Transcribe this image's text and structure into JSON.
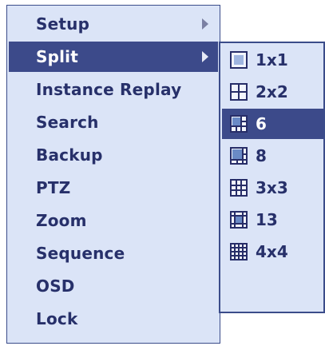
{
  "menu": {
    "items": [
      {
        "label": "Setup",
        "has_submenu": true
      },
      {
        "label": "Split",
        "has_submenu": true,
        "active": true
      },
      {
        "label": "Instance Replay"
      },
      {
        "label": "Search"
      },
      {
        "label": "Backup"
      },
      {
        "label": "PTZ"
      },
      {
        "label": "Zoom"
      },
      {
        "label": "Sequence"
      },
      {
        "label": "OSD"
      },
      {
        "label": "Lock"
      }
    ]
  },
  "split_submenu": {
    "items": [
      {
        "label": "1x1",
        "icon": "split-1x1-icon"
      },
      {
        "label": "2x2",
        "icon": "split-2x2-icon"
      },
      {
        "label": "6",
        "icon": "split-6-icon",
        "active": true
      },
      {
        "label": "8",
        "icon": "split-8-icon"
      },
      {
        "label": "3x3",
        "icon": "split-3x3-icon"
      },
      {
        "label": "13",
        "icon": "split-13-icon"
      },
      {
        "label": "4x4",
        "icon": "split-4x4-icon"
      }
    ]
  },
  "colors": {
    "menu_background": "#dbe4f7",
    "border": "#3b4c8a",
    "highlight": "#3c4a8a",
    "text": "#27306a",
    "highlight_text": "#ffffff"
  }
}
